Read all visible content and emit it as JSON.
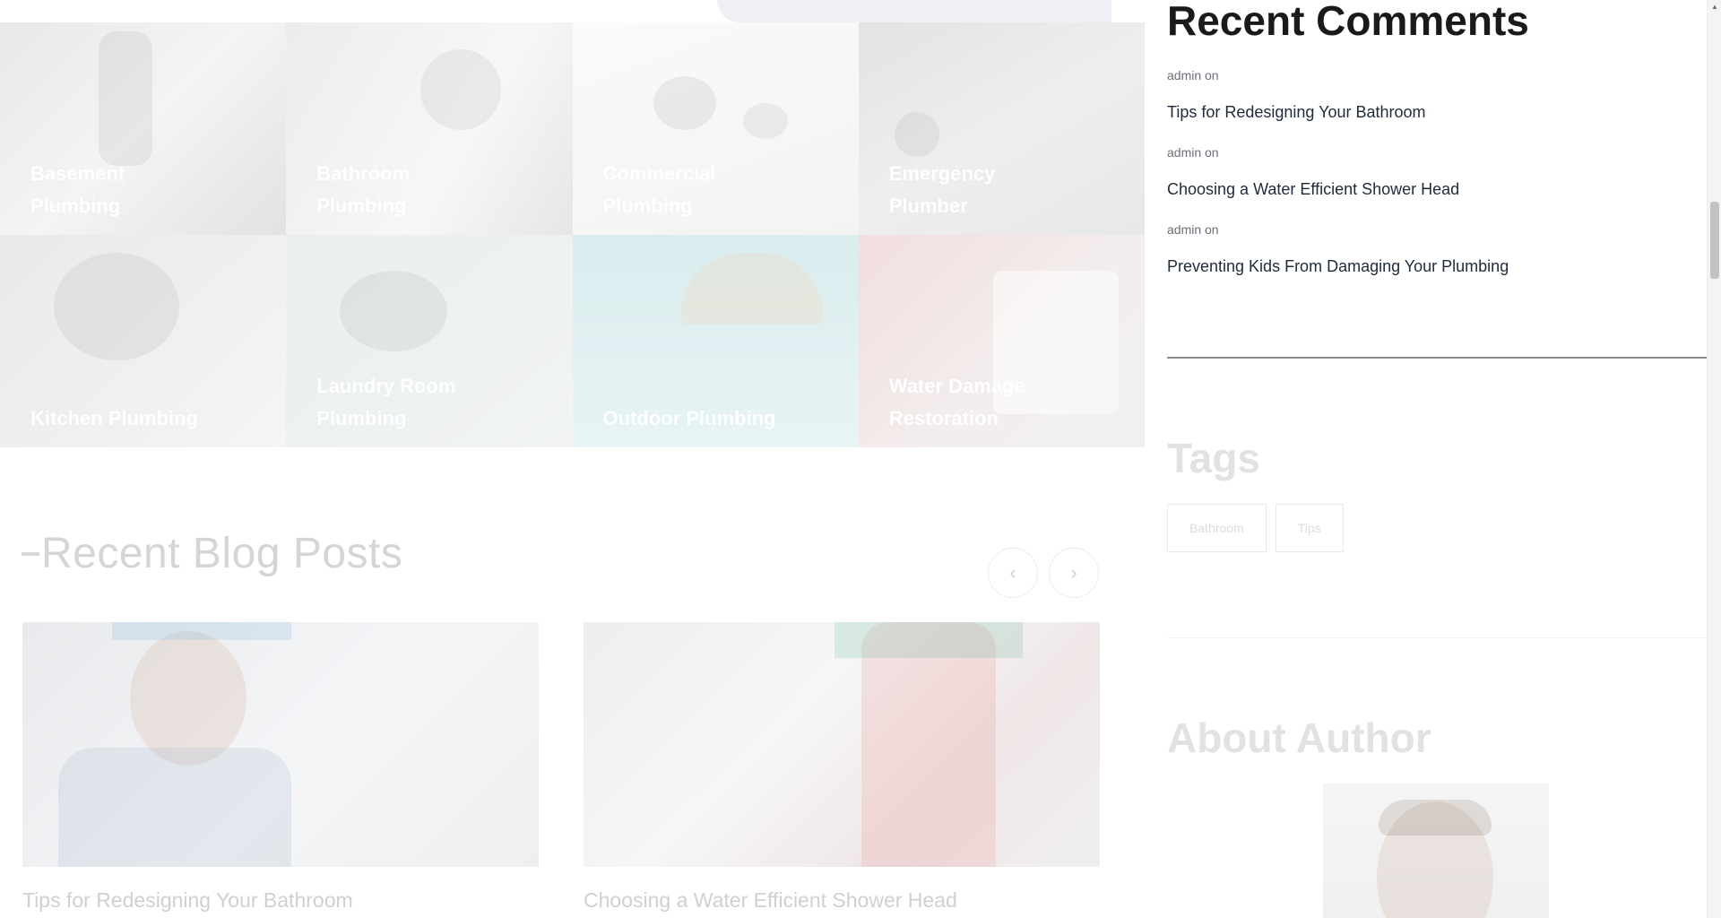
{
  "services": [
    {
      "label": "Basement Plumbing"
    },
    {
      "label": "Bathroom Plumbing"
    },
    {
      "label": "Commercial Plumbing"
    },
    {
      "label": "Emergency Plumber"
    },
    {
      "label": "Kitchen Plumbing"
    },
    {
      "label": "Laundry Room Plumbing"
    },
    {
      "label": "Outdoor Plumbing"
    },
    {
      "label": "Water Damage Restoration"
    }
  ],
  "blog": {
    "section_title": "Recent Blog Posts",
    "prev_icon": "chevron-left-icon",
    "next_icon": "chevron-right-icon",
    "prev_glyph": "‹",
    "next_glyph": "›",
    "posts": [
      {
        "title": "Tips for Redesigning Your Bathroom"
      },
      {
        "title": "Choosing a Water Efficient Shower Head"
      }
    ]
  },
  "sidebar": {
    "recent_comments_title": "Recent Comments",
    "comments": [
      {
        "meta": "admin on",
        "post": "Tips for Redesigning Your Bathroom"
      },
      {
        "meta": "admin on",
        "post": "Choosing a Water Efficient Shower Head"
      },
      {
        "meta": "admin on",
        "post": "Preventing Kids From Damaging Your Plumbing"
      }
    ],
    "tags_title": "Tags",
    "tags": [
      "Bathroom",
      "Tips"
    ],
    "about_title": "About Author"
  },
  "scrollbar": {
    "up_glyph": "▲"
  }
}
